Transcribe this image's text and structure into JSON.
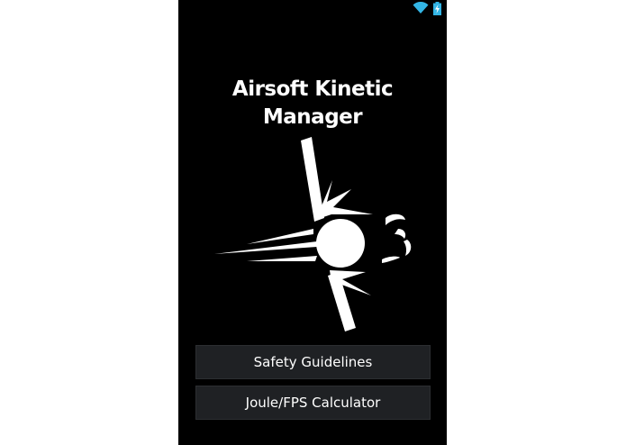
{
  "colors": {
    "background": "#000000",
    "text": "#ffffff",
    "button_background": "#1f2124",
    "status_icon": "#33b5e5"
  },
  "status_bar": {
    "icons": [
      "wifi-icon",
      "battery-charging-icon"
    ]
  },
  "app": {
    "title_line1": "Airsoft Kinetic",
    "title_line2": "Manager",
    "logo_icon": "bb-impact-logo"
  },
  "menu": {
    "items": [
      {
        "label": "Safety Guidelines"
      },
      {
        "label": "Joule/FPS Calculator"
      }
    ]
  }
}
